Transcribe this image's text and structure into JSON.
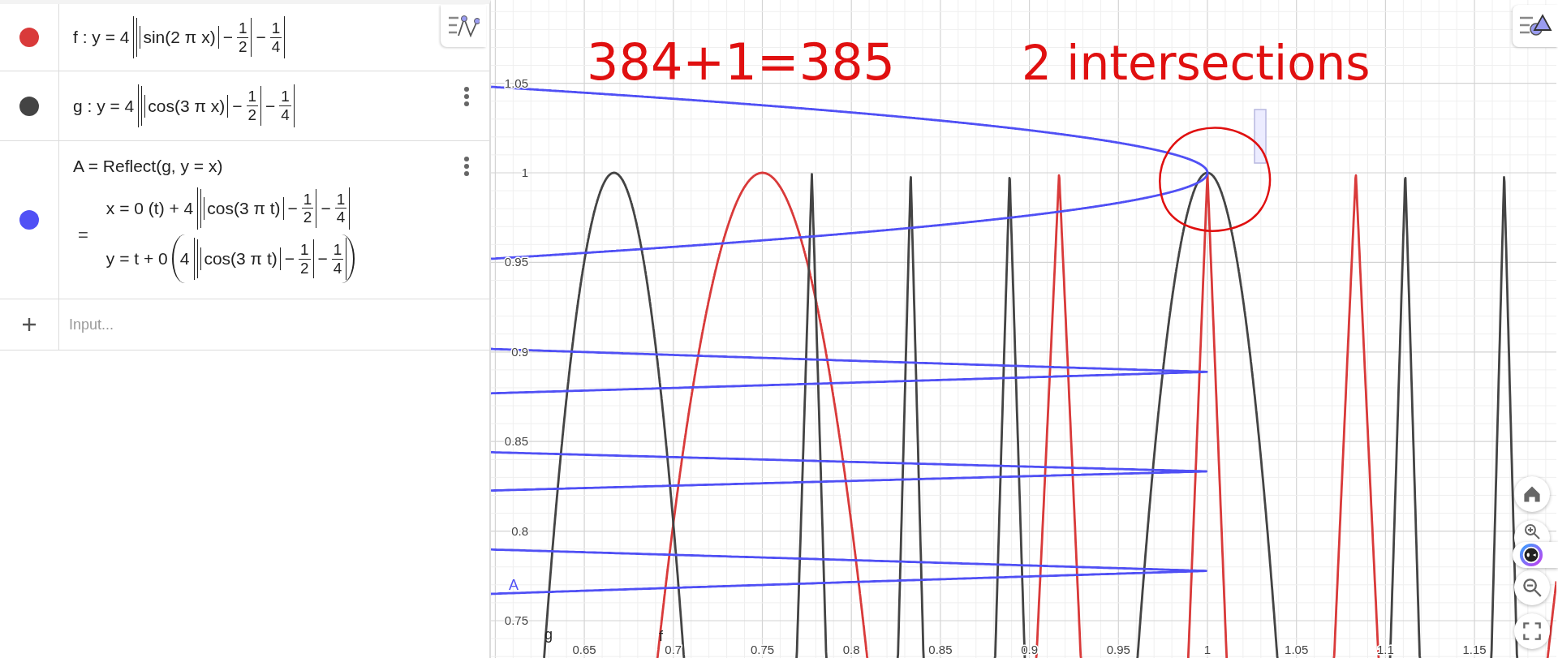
{
  "algebra": {
    "items": [
      {
        "kind": "function",
        "color": "#d93a3a",
        "label": "f",
        "definition": [
          {
            "kind": "text",
            "text": "f : y = 4"
          },
          {
            "kind": "abs",
            "items": [
              {
                "kind": "abs",
                "items": [
                  {
                    "kind": "abs",
                    "items": [
                      {
                        "kind": "text",
                        "text": "sin(2 π x)"
                      }
                    ]
                  },
                  {
                    "kind": "text",
                    "text": "−"
                  },
                  {
                    "kind": "frac",
                    "num": "1",
                    "den": "2"
                  }
                ]
              },
              {
                "kind": "text",
                "text": "−"
              },
              {
                "kind": "frac",
                "num": "1",
                "den": "4"
              }
            ]
          }
        ]
      },
      {
        "kind": "function",
        "color": "#444444",
        "label": "g",
        "definition": [
          {
            "kind": "text",
            "text": "g : y = 4"
          },
          {
            "kind": "abs",
            "items": [
              {
                "kind": "abs",
                "items": [
                  {
                    "kind": "abs",
                    "items": [
                      {
                        "kind": "text",
                        "text": "cos(3 π x)"
                      }
                    ]
                  },
                  {
                    "kind": "text",
                    "text": "−"
                  },
                  {
                    "kind": "frac",
                    "num": "1",
                    "den": "2"
                  }
                ]
              },
              {
                "kind": "text",
                "text": "−"
              },
              {
                "kind": "frac",
                "num": "1",
                "den": "4"
              }
            ]
          }
        ]
      },
      {
        "kind": "curve",
        "color": "#5050f5",
        "label": "A",
        "definition": [
          {
            "kind": "text",
            "text": "A = Reflect(g, y = x)"
          }
        ],
        "value_sign": "=",
        "value": [
          [
            {
              "kind": "text",
              "text": "x = 0 (t) + 4"
            },
            {
              "kind": "abs",
              "items": [
                {
                  "kind": "abs",
                  "items": [
                    {
                      "kind": "abs",
                      "items": [
                        {
                          "kind": "text",
                          "text": "cos(3 π t)"
                        }
                      ]
                    },
                    {
                      "kind": "text",
                      "text": "−"
                    },
                    {
                      "kind": "frac",
                      "num": "1",
                      "den": "2"
                    }
                  ]
                },
                {
                  "kind": "text",
                  "text": "−"
                },
                {
                  "kind": "frac",
                  "num": "1",
                  "den": "4"
                }
              ]
            }
          ],
          [
            {
              "kind": "text",
              "text": "y = t + 0"
            },
            {
              "kind": "paren",
              "items": [
                {
                  "kind": "text",
                  "text": "4"
                },
                {
                  "kind": "abs",
                  "items": [
                    {
                      "kind": "abs",
                      "items": [
                        {
                          "kind": "abs",
                          "items": [
                            {
                              "kind": "text",
                              "text": "cos(3 π t)"
                            }
                          ]
                        },
                        {
                          "kind": "text",
                          "text": "−"
                        },
                        {
                          "kind": "frac",
                          "num": "1",
                          "den": "2"
                        }
                      ]
                    },
                    {
                      "kind": "text",
                      "text": "−"
                    },
                    {
                      "kind": "frac",
                      "num": "1",
                      "den": "4"
                    }
                  ]
                }
              ]
            }
          ]
        ]
      }
    ],
    "input": {
      "placeholder": "Input..."
    }
  },
  "graph": {
    "x_labels": [
      "0.65",
      "0.7",
      "0.75",
      "0.8",
      "0.85",
      "0.9",
      "0.95",
      "1",
      "1.05",
      "1.1",
      "1.15"
    ],
    "y_labels": [
      "1.05",
      "1",
      "0.95",
      "0.9",
      "0.85",
      "0.8",
      "0.75"
    ],
    "note": [
      "384+1=385",
      "2 intersections"
    ]
  }
}
